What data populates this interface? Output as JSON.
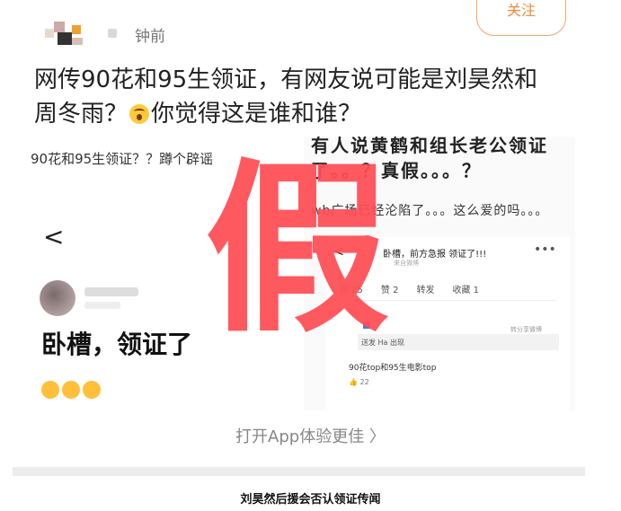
{
  "header": {
    "time_text": "钟前",
    "follow_label": "关注"
  },
  "post": {
    "line1": "网传90花和95生领证，有网友说可能是刘昊然和",
    "line2_before": "周冬雨？",
    "line2_after": "你觉得这是谁和谁？"
  },
  "image": {
    "left_caption": "90花和95生领证？？蹲个辟谣",
    "left_back": "<",
    "left_text": "卧槽，领证了",
    "right_line1": "有人说黄鹤和组长老公领证",
    "right_line2": "了。。？真假。。。？",
    "right_line3": "wb广场已经沦陷了。。。这么爱的吗。。。",
    "phone": {
      "back": "<",
      "title": "卧槽，前方急报 领证了!!!",
      "subtitle": "来自微博",
      "more": "•••",
      "tabs": [
        "评 25",
        "赞 2",
        "转发",
        "收藏 1"
      ],
      "other": "转分享微博",
      "reply": "送发 Ha 出现",
      "post_text": "90花top和95生电影top",
      "likes": "22"
    },
    "stamp_text": "假"
  },
  "open_app": "打开App体验更佳 〉",
  "caption": "刘昊然后援会否认领证传闻",
  "colors": {
    "stamp": "#ff4d55",
    "accent": "#f08a3c"
  }
}
